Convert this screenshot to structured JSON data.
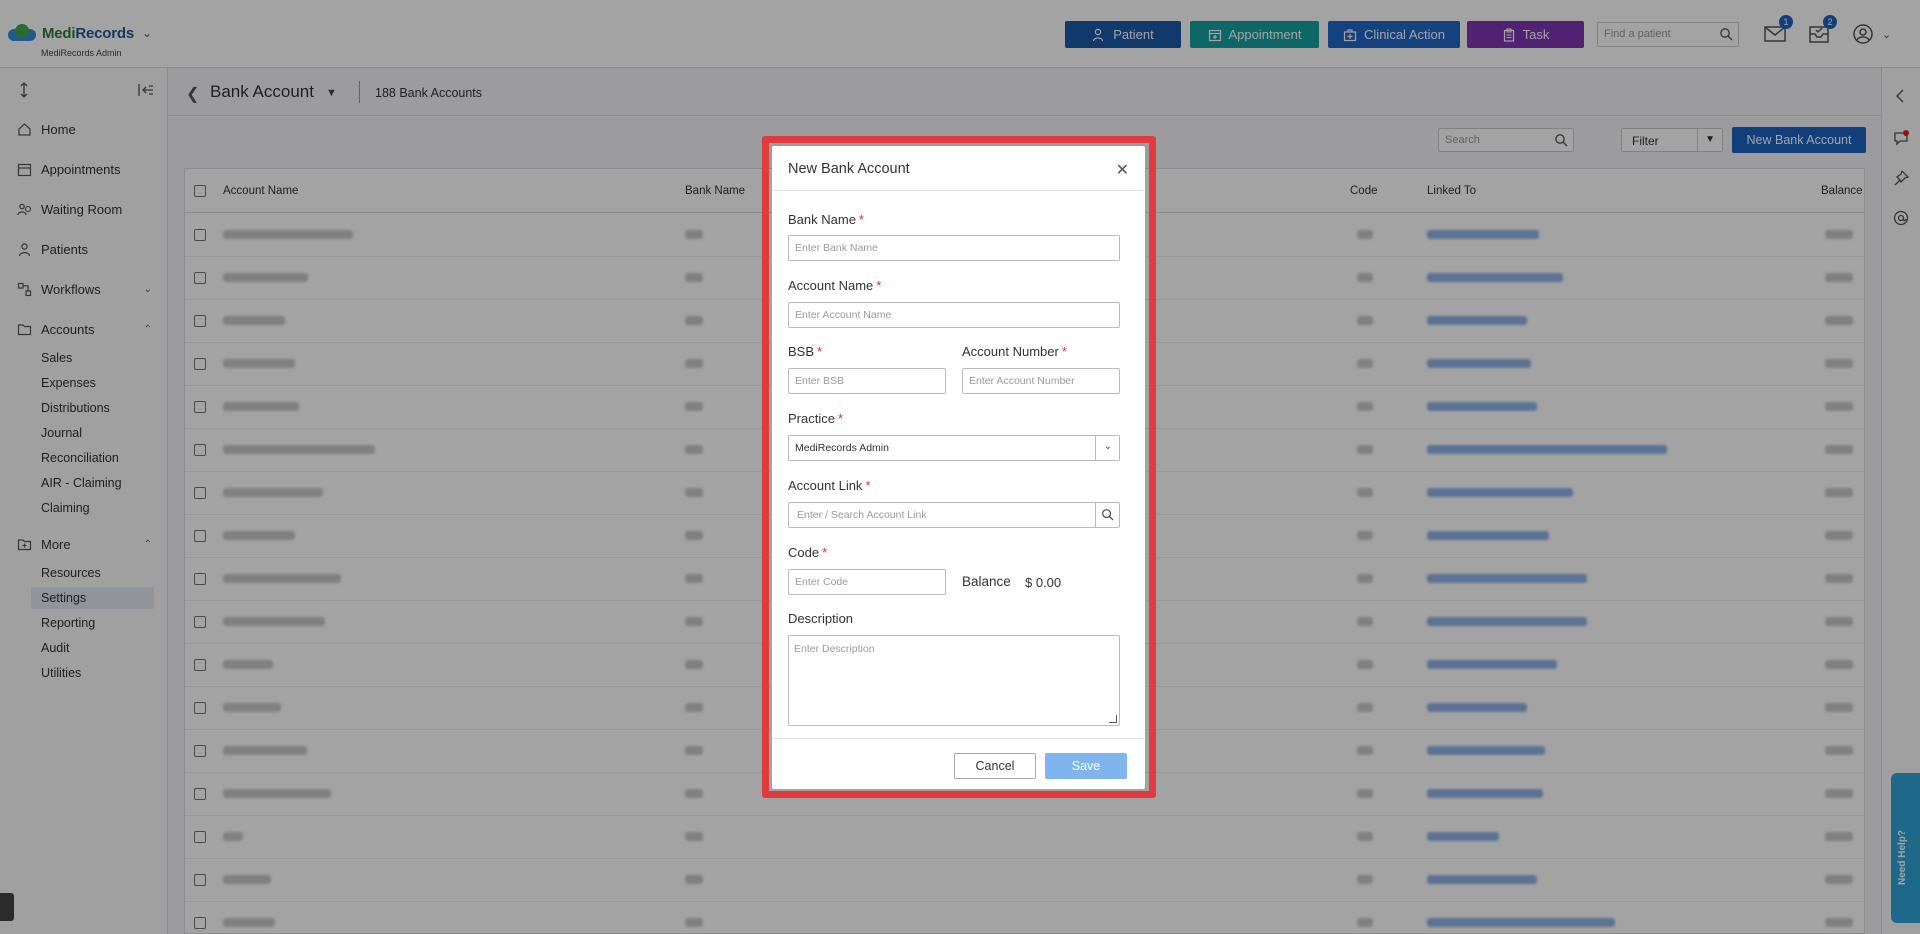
{
  "app": {
    "logo_text_part1": "Medi",
    "logo_text_part2": "Records",
    "org_name": "MediRecords Admin"
  },
  "top_actions": {
    "patient": "Patient",
    "appointment": "Appointment",
    "clinical_action": "Clinical Action",
    "task": "Task",
    "find_placeholder": "Find a patient",
    "mail_badge": "1",
    "tasks_badge": "2"
  },
  "sidebar": {
    "home": "Home",
    "appointments": "Appointments",
    "waiting_room": "Waiting Room",
    "patients": "Patients",
    "workflows": "Workflows",
    "accounts": "Accounts",
    "accounts_items": [
      "Sales",
      "Expenses",
      "Distributions",
      "Journal",
      "Reconciliation",
      "AIR - Claiming",
      "Claiming"
    ],
    "more": "More",
    "more_items": [
      "Resources",
      "Settings",
      "Reporting",
      "Audit",
      "Utilities"
    ],
    "active_item": "Settings"
  },
  "page": {
    "title": "Bank Account",
    "count": "188 Bank Accounts",
    "search_placeholder": "Search",
    "filter_label": "Filter",
    "new_button": "New Bank Account"
  },
  "table": {
    "columns": {
      "account_name": "Account Name",
      "bank_name": "Bank Name",
      "code": "Code",
      "linked_to": "Linked To",
      "balance": "Balance"
    }
  },
  "modal": {
    "title": "New Bank Account",
    "bank_name_label": "Bank Name",
    "bank_name_placeholder": "Enter Bank Name",
    "account_name_label": "Account Name",
    "account_name_placeholder": "Enter Account Name",
    "bsb_label": "BSB",
    "bsb_placeholder": "Enter BSB",
    "account_number_label": "Account Number",
    "account_number_placeholder": "Enter Account Number",
    "practice_label": "Practice",
    "practice_value": "MediRecords Admin",
    "account_link_label": "Account Link",
    "account_link_placeholder": "Enter / Search Account Link",
    "code_label": "Code",
    "code_placeholder": "Enter Code",
    "balance_label": "Balance",
    "balance_value": "$ 0.00",
    "description_label": "Description",
    "description_placeholder": "Enter Description",
    "required_mark": "*",
    "cancel": "Cancel",
    "save": "Save"
  },
  "help": {
    "label": "Need Help?"
  }
}
